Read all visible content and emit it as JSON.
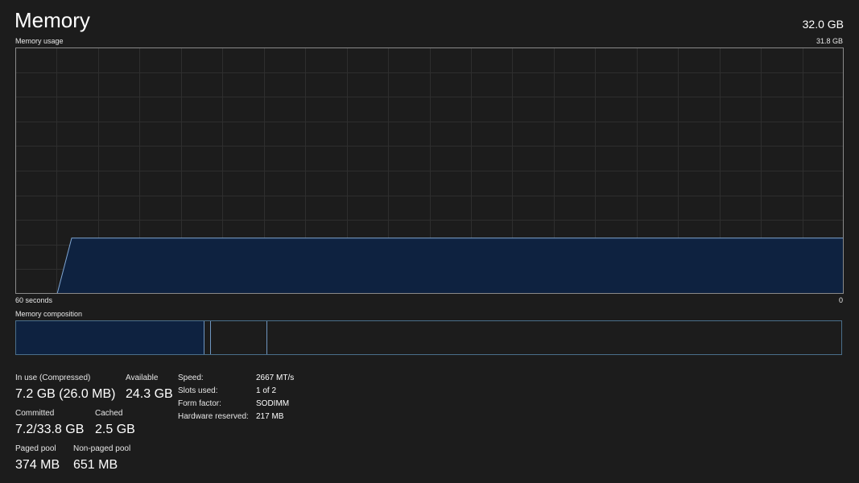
{
  "header": {
    "title": "Memory",
    "total": "32.0 GB"
  },
  "usage_graph": {
    "label": "Memory usage",
    "max_label": "31.8 GB",
    "time_label": "60 seconds",
    "zero_label": "0",
    "fill_color": "#0e2240",
    "line_color": "#7fa6d4",
    "grid_color": "#2e2e2e",
    "chart_data": {
      "type": "area",
      "x_range_seconds": [
        60,
        0
      ],
      "ylim": [
        0,
        31.8
      ],
      "series": [
        {
          "values_gb": [
            0,
            0,
            7.2,
            7.2,
            7.2,
            7.2,
            7.2,
            7.2,
            7.2,
            7.2,
            7.2,
            7.2,
            7.2,
            7.2,
            7.2,
            7.2,
            7.2,
            7.2,
            7.2,
            7.2
          ]
        }
      ]
    }
  },
  "composition": {
    "label": "Memory composition",
    "in_use_fraction": 0.227,
    "modified_fraction": 0.008,
    "standby_fraction": 0.068,
    "in_use_color": "#0e2240",
    "divider_color": "#6f96c0"
  },
  "stats": {
    "in_use_label": "In use (Compressed)",
    "in_use_value": "7.2 GB (26.0 MB)",
    "available_label": "Available",
    "available_value": "24.3 GB",
    "committed_label": "Committed",
    "committed_value": "7.2/33.8 GB",
    "cached_label": "Cached",
    "cached_value": "2.5 GB",
    "paged_label": "Paged pool",
    "paged_value": "374 MB",
    "nonpaged_label": "Non-paged pool",
    "nonpaged_value": "651 MB"
  },
  "specs": [
    {
      "label": "Speed:",
      "value": "2667 MT/s"
    },
    {
      "label": "Slots used:",
      "value": "1 of 2"
    },
    {
      "label": "Form factor:",
      "value": "SODIMM"
    },
    {
      "label": "Hardware reserved:",
      "value": "217 MB"
    }
  ]
}
